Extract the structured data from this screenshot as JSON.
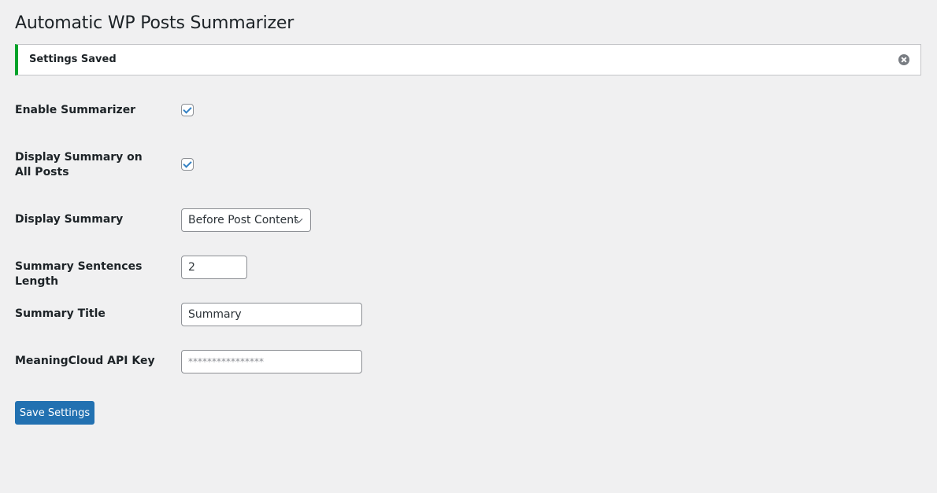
{
  "page": {
    "title": "Automatic WP Posts Summarizer"
  },
  "notice": {
    "text": "Settings Saved",
    "type": "success",
    "accent_color": "#00a32a",
    "dismiss_icon": "close-circle-icon"
  },
  "settings": {
    "enable_summarizer": {
      "label": "Enable Summarizer",
      "checked": true
    },
    "display_on_all_posts": {
      "label": "Display Summary on All Posts",
      "checked": true
    },
    "display_summary": {
      "label": "Display Summary",
      "selected": "Before Post Content"
    },
    "sentences_length": {
      "label": "Summary Sentences Length",
      "value": "2"
    },
    "summary_title": {
      "label": "Summary Title",
      "value": "Summary"
    },
    "api_key": {
      "label": "MeaningCloud API Key",
      "placeholder": "****************"
    }
  },
  "actions": {
    "save_label": "Save Settings",
    "primary_color": "#2271b1"
  }
}
